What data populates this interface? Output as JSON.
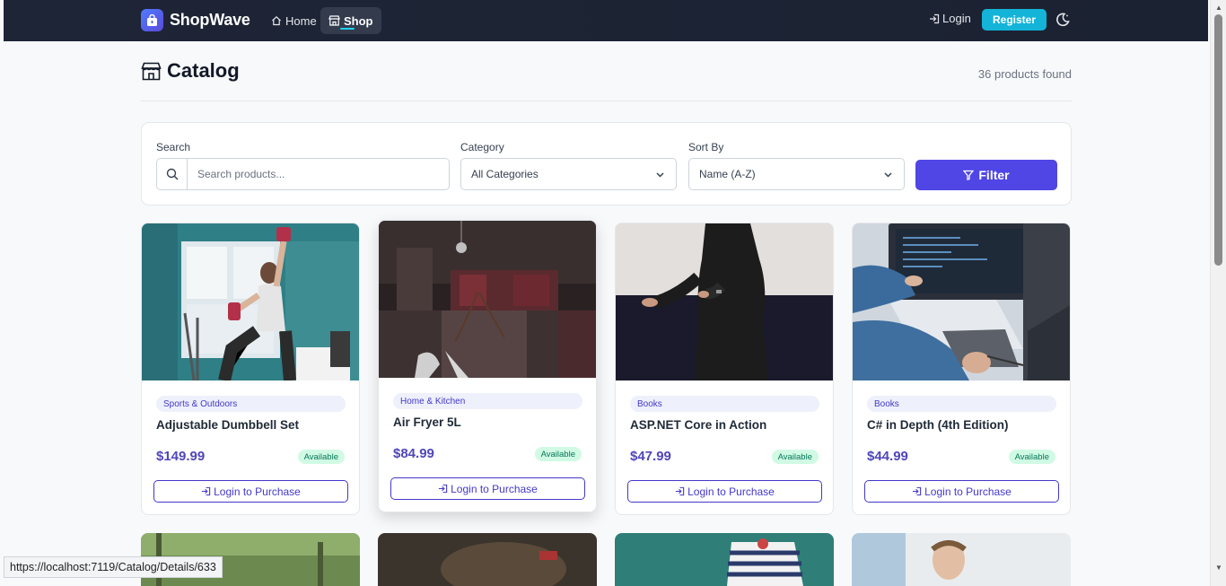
{
  "brand": {
    "name": "ShopWave"
  },
  "nav": {
    "home": "Home",
    "shop": "Shop",
    "login": "Login",
    "register": "Register"
  },
  "header": {
    "title": "Catalog",
    "count": "36 products found"
  },
  "filters": {
    "search_label": "Search",
    "search_placeholder": "Search products...",
    "category_label": "Category",
    "category_value": "All Categories",
    "sort_label": "Sort By",
    "sort_value": "Name (A-Z)",
    "filter_button": "Filter"
  },
  "products": [
    {
      "category": "Sports & Outdoors",
      "name": "Adjustable Dumbbell Set",
      "price": "$149.99",
      "status": "Available",
      "action": "Login to Purchase"
    },
    {
      "category": "Home & Kitchen",
      "name": "Air Fryer 5L",
      "price": "$84.99",
      "status": "Available",
      "action": "Login to Purchase"
    },
    {
      "category": "Books",
      "name": "ASP.NET Core in Action",
      "price": "$47.99",
      "status": "Available",
      "action": "Login to Purchase"
    },
    {
      "category": "Books",
      "name": "C# in Depth (4th Edition)",
      "price": "$44.99",
      "status": "Available",
      "action": "Login to Purchase"
    }
  ],
  "status_bar": {
    "url": "https://localhost:7119/Catalog/Details/633"
  },
  "colors": {
    "accent": "#4f46e5",
    "nav_bg": "#1e2536",
    "register": "#13b4d8",
    "available": "#047857"
  }
}
